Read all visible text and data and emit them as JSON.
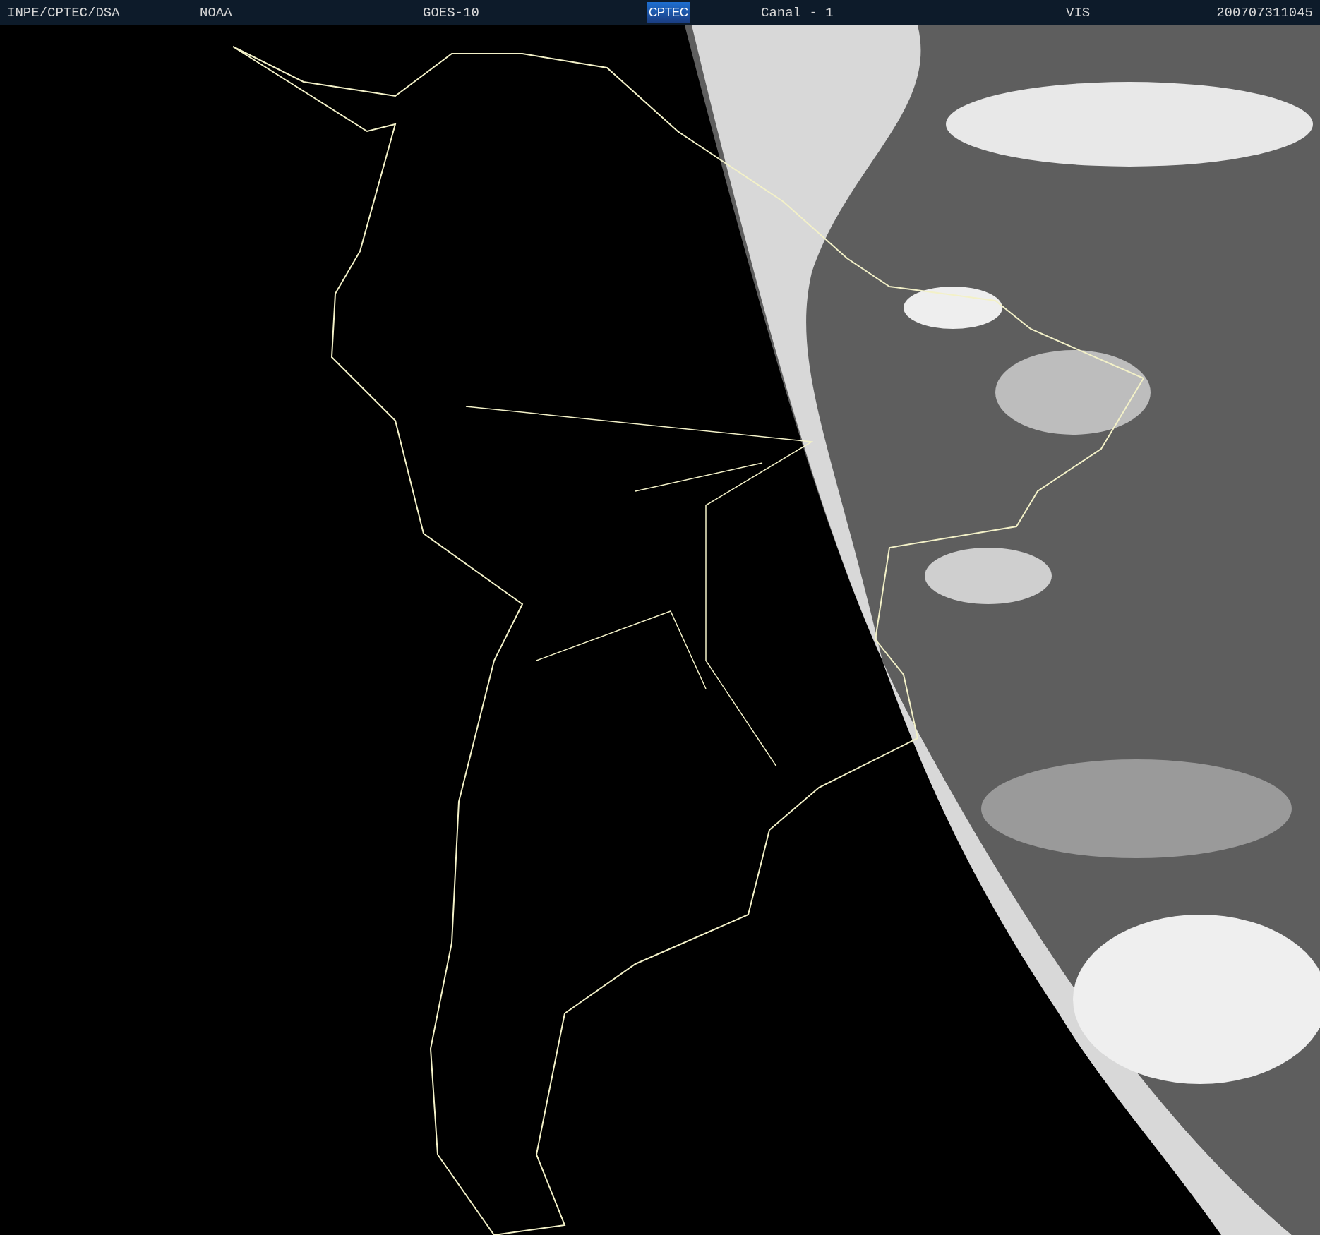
{
  "header": {
    "items": [
      {
        "kind": "text",
        "text": "INPE/CPTEC/DSA"
      },
      {
        "kind": "text",
        "text": "NOAA"
      },
      {
        "kind": "text",
        "text": "GOES-10"
      },
      {
        "kind": "logo",
        "text": "CPTEC"
      },
      {
        "kind": "text",
        "text": "Canal - 1"
      },
      {
        "kind": "text",
        "text": "VIS"
      },
      {
        "kind": "text",
        "text": "200707311045"
      }
    ]
  }
}
